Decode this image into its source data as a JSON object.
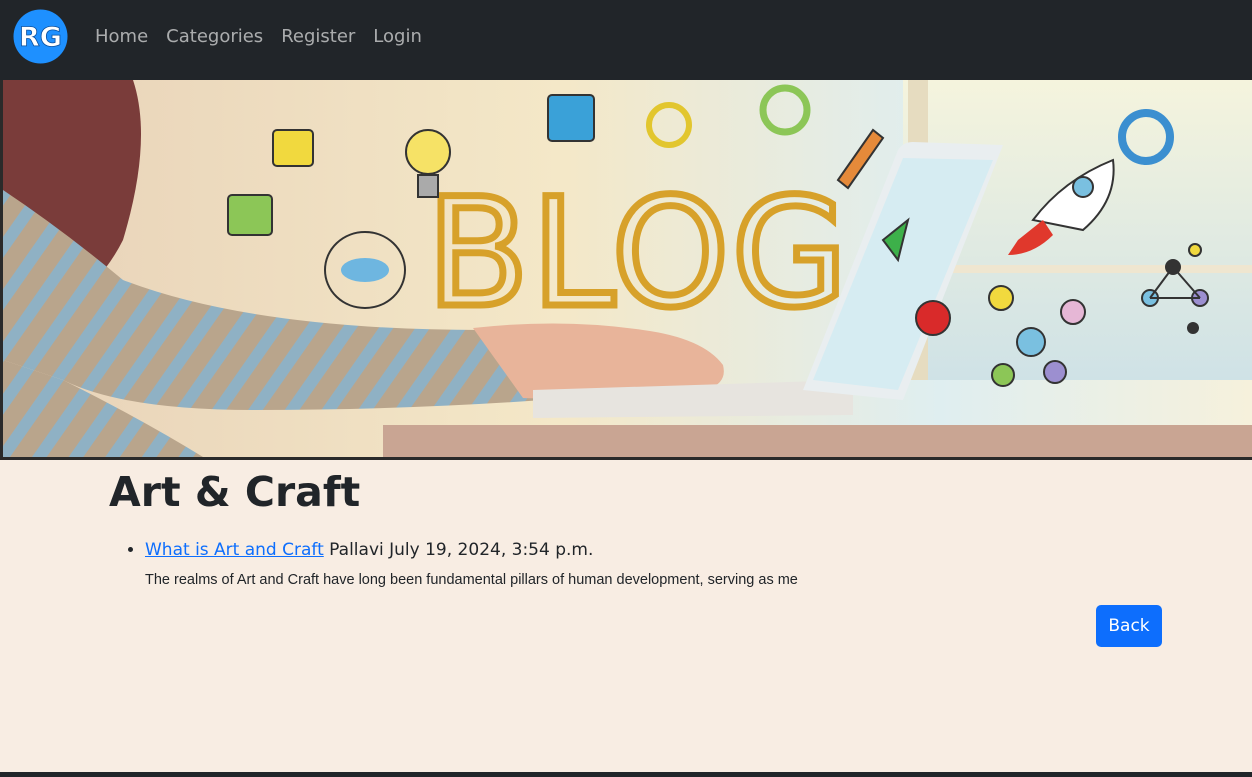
{
  "navbar": {
    "logo_text": "RG",
    "links": [
      "Home",
      "Categories",
      "Register",
      "Login"
    ]
  },
  "hero": {
    "banner_word": "BLOG"
  },
  "category": {
    "title": "Art & Craft"
  },
  "posts": [
    {
      "title": "What is Art and Craft",
      "author": "Pallavi",
      "date": "July 19, 2024, 3:54 p.m.",
      "excerpt": "The realms of Art and Craft have long been fundamental pillars of human development, serving as me"
    }
  ],
  "actions": {
    "back_label": "Back"
  },
  "colors": {
    "navbar_bg": "#212529",
    "page_bg": "#f8ede3",
    "link": "#0d6efd",
    "button": "#0d6efd",
    "logo_blue": "#1e90ff"
  }
}
